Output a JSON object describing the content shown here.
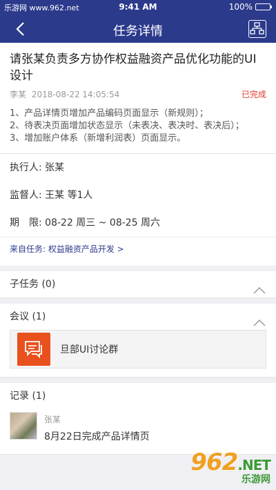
{
  "statusbar": {
    "carrier": "乐游网 www.962.net",
    "time": "9:41 AM",
    "battery": "100%"
  },
  "navbar": {
    "title": "任务详情"
  },
  "task": {
    "title": "请张某负责多方协作权益融资产品优化功能的UI设计",
    "author": "李某",
    "datetime": "2018-08-22 14:05:54",
    "status": "已完成",
    "desc_lines": [
      "1、产品详情页增加产品编码页面显示（新规则）；",
      "2、待表决页面增加状态显示（未表决、表决时、表决后）；",
      "3、增加账户体系（新增利润表）页面显示。"
    ]
  },
  "fields": {
    "executor": "执行人: 张某",
    "supervisor": "监督人: 王某  等1人",
    "period": "期　限: 08-22 周三 ~ 08-25 周六"
  },
  "source_link": "来自任务: 权益融资产品开发 >",
  "subtasks": {
    "label": "子任务 (0)"
  },
  "meetings": {
    "label": "会议 (1)",
    "item": "旦部UI讨论群"
  },
  "records": {
    "label": "记录 (1)",
    "name": "张某",
    "text": "8月22日完成产品详情页"
  },
  "watermark": {
    "main": "962",
    "net": ".NET",
    "sub": "乐游网"
  },
  "colors": {
    "nav": "#2c3a8c",
    "status": "#e03a2f",
    "meeting_icon": "#e8501d"
  },
  "icons": [
    "back-arrow-icon",
    "org-chart-icon",
    "chevron-up-icon",
    "chat-icon",
    "battery-icon"
  ]
}
